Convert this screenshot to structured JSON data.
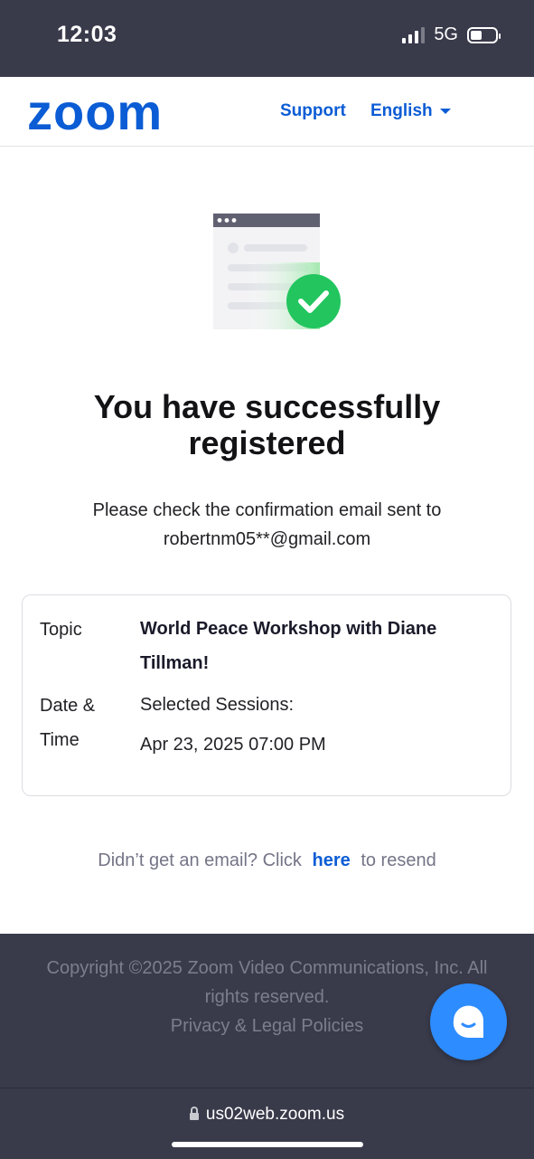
{
  "status_bar": {
    "time": "12:03",
    "network": "5G"
  },
  "header": {
    "support_label": "Support",
    "language_label": "English"
  },
  "main": {
    "title": "You have successfully registered",
    "message_line1": "Please check the confirmation email sent to",
    "message_line2": "robertnm05**@gmail.com"
  },
  "details": {
    "topic_label": "Topic",
    "topic_value": "World Peace Workshop with Diane Tillman!",
    "datetime_label": "Date & Time",
    "sessions_label": "Selected Sessions:",
    "session_value": "Apr 23, 2025 07:00 PM"
  },
  "resend": {
    "prefix": "Didn’t get an email? Click",
    "link": "here",
    "suffix": "to resend"
  },
  "footer": {
    "copyright": "Copyright ©2025 Zoom Video Communications, Inc. All rights reserved.",
    "policy_link": "Privacy & Legal Policies"
  },
  "browser": {
    "url": "us02web.zoom.us"
  },
  "colors": {
    "brand": "#0b5cd5",
    "chat_button": "#2d8cff",
    "success": "#22c55e",
    "dark_bg": "#393a4a"
  },
  "icons": [
    "signal-icon",
    "battery-icon",
    "chevron-down-icon",
    "checkmark-icon",
    "chat-icon",
    "lock-icon"
  ]
}
